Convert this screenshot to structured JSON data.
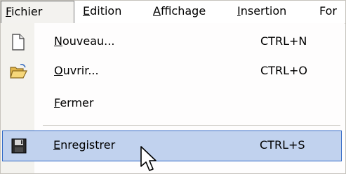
{
  "menubar": {
    "items": [
      {
        "first": "F",
        "rest": "ichier"
      },
      {
        "first": "E",
        "rest": "dition"
      },
      {
        "first": "A",
        "rest": "ffichage"
      },
      {
        "first": "I",
        "rest": "nsertion"
      },
      {
        "first": "",
        "rest": "For"
      }
    ]
  },
  "dropdown": {
    "items": [
      {
        "first": "N",
        "rest": "ouveau...",
        "shortcut": "CTRL+N",
        "icon": "new-document-icon"
      },
      {
        "first": "O",
        "rest": "uvrir...",
        "shortcut": "CTRL+O",
        "icon": "open-folder-icon"
      },
      {
        "first": "F",
        "rest": "ermer",
        "shortcut": "",
        "icon": ""
      },
      {
        "first": "E",
        "rest": "nregistrer",
        "shortcut": "CTRL+S",
        "icon": "floppy-disk-icon"
      }
    ],
    "highlighted_index": 3
  },
  "colors": {
    "highlight_bg": "#c1d2ee",
    "highlight_border": "#3169c6",
    "icon_strip": "#f3f2ee"
  }
}
